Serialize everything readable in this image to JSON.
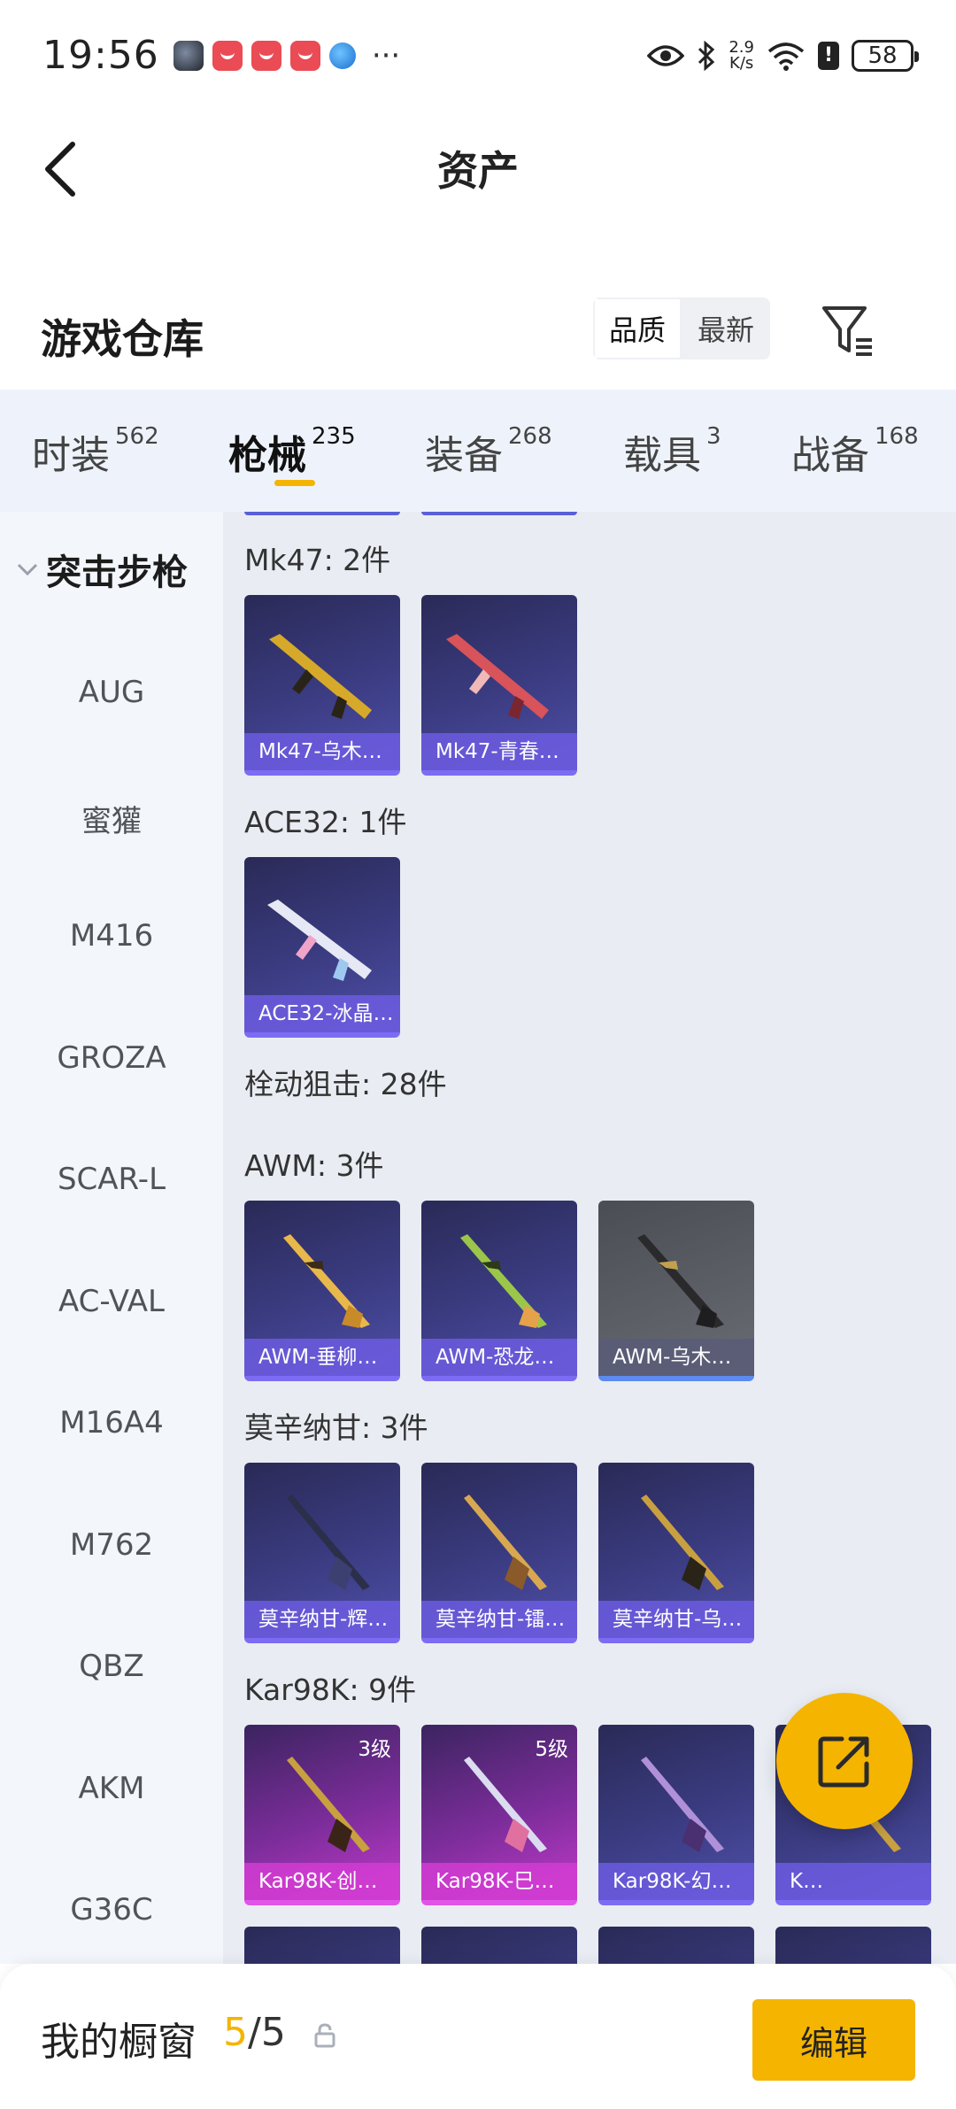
{
  "status_bar": {
    "time": "19:56",
    "more": "···",
    "net_speed_value": "2.9",
    "net_speed_unit": "K/s",
    "battery": "58"
  },
  "nav": {
    "title": "资产"
  },
  "warehouse": {
    "title": "游戏仓库",
    "sort_options": [
      "品质",
      "最新"
    ],
    "sort_selected": "品质"
  },
  "tabs": [
    {
      "label": "时装",
      "count": "562"
    },
    {
      "label": "枪械",
      "count": "235",
      "active": true
    },
    {
      "label": "装备",
      "count": "268"
    },
    {
      "label": "载具",
      "count": "3"
    },
    {
      "label": "战备",
      "count": "168"
    }
  ],
  "sidebar": {
    "group": "突击步枪",
    "items": [
      "AUG",
      "蜜獾",
      "M416",
      "GROZA",
      "SCAR-L",
      "AC-VAL",
      "M16A4",
      "M762",
      "QBZ",
      "AKM",
      "G36C"
    ]
  },
  "sections": {
    "mk47": {
      "title": "Mk47: 2件",
      "items": [
        "Mk47-乌木…",
        "Mk47-青春…"
      ]
    },
    "ace32": {
      "title": "ACE32: 1件",
      "items": [
        "ACE32-冰晶…"
      ]
    },
    "bolt": {
      "title": "栓动狙击: 28件"
    },
    "awm": {
      "title": "AWM: 3件",
      "items": [
        "AWM-垂柳…",
        "AWM-恐龙…",
        "AWM-乌木…"
      ]
    },
    "mosin": {
      "title": "莫辛纳甘: 3件",
      "items": [
        "莫辛纳甘-辉…",
        "莫辛纳甘-镭…",
        "莫辛纳甘-乌…"
      ]
    },
    "kar98k": {
      "title": "Kar98K: 9件",
      "items": [
        "Kar98K-创…",
        "Kar98K-巳…",
        "Kar98K-幻…",
        "K…"
      ],
      "levels": [
        "3级",
        "5级"
      ]
    }
  },
  "bottom": {
    "showcase_label": "我的橱窗",
    "current": "5",
    "separator": "/",
    "max": "5",
    "edit_label": "编辑"
  },
  "colors": {
    "accent": "#f5b400",
    "card_purple": "#3b3c82",
    "card_pink": "#c23ac9"
  }
}
